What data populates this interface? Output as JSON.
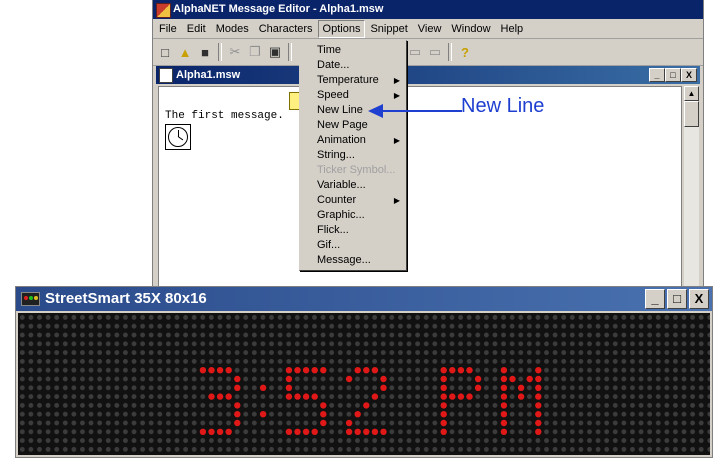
{
  "editor": {
    "title": "AlphaNET Message Editor - Alpha1.msw",
    "menu": [
      "File",
      "Edit",
      "Modes",
      "Characters",
      "Options",
      "Snippet",
      "View",
      "Window",
      "Help"
    ],
    "active_menu": "Options",
    "toolbar_icons": [
      "new-icon",
      "open-icon",
      "save-icon",
      "cut-icon",
      "copy-icon",
      "paste-icon",
      "print-icon",
      "format-icon",
      "format-icon",
      "format-icon",
      "help-icon"
    ]
  },
  "child_window": {
    "title": "Alpha1.msw",
    "text": "The first message.",
    "controls": [
      "_",
      "□",
      "X"
    ]
  },
  "options_menu": [
    {
      "label": "Time",
      "submenu": false,
      "disabled": false
    },
    {
      "label": "Date...",
      "submenu": false,
      "disabled": false
    },
    {
      "label": "Temperature",
      "submenu": true,
      "disabled": false
    },
    {
      "label": "Speed",
      "submenu": true,
      "disabled": false
    },
    {
      "label": "New Line",
      "submenu": false,
      "disabled": false
    },
    {
      "label": "New Page",
      "submenu": false,
      "disabled": false
    },
    {
      "label": "Animation",
      "submenu": true,
      "disabled": false
    },
    {
      "label": "String...",
      "submenu": false,
      "disabled": false
    },
    {
      "label": "Ticker Symbol...",
      "submenu": false,
      "disabled": true
    },
    {
      "label": "Variable...",
      "submenu": false,
      "disabled": false
    },
    {
      "label": "Counter",
      "submenu": true,
      "disabled": false
    },
    {
      "label": "Graphic...",
      "submenu": false,
      "disabled": false
    },
    {
      "label": "Flick...",
      "submenu": false,
      "disabled": false
    },
    {
      "label": "Gif...",
      "submenu": false,
      "disabled": false
    },
    {
      "label": "Message...",
      "submenu": false,
      "disabled": false
    }
  ],
  "annotation": {
    "label": "New Line",
    "color": "#1f3fd0"
  },
  "led_window": {
    "title": "StreetSmart 35X 80x16",
    "display_text": "3:52 PM",
    "led_color": "#e01818",
    "controls": [
      "_",
      "□",
      "X"
    ]
  }
}
